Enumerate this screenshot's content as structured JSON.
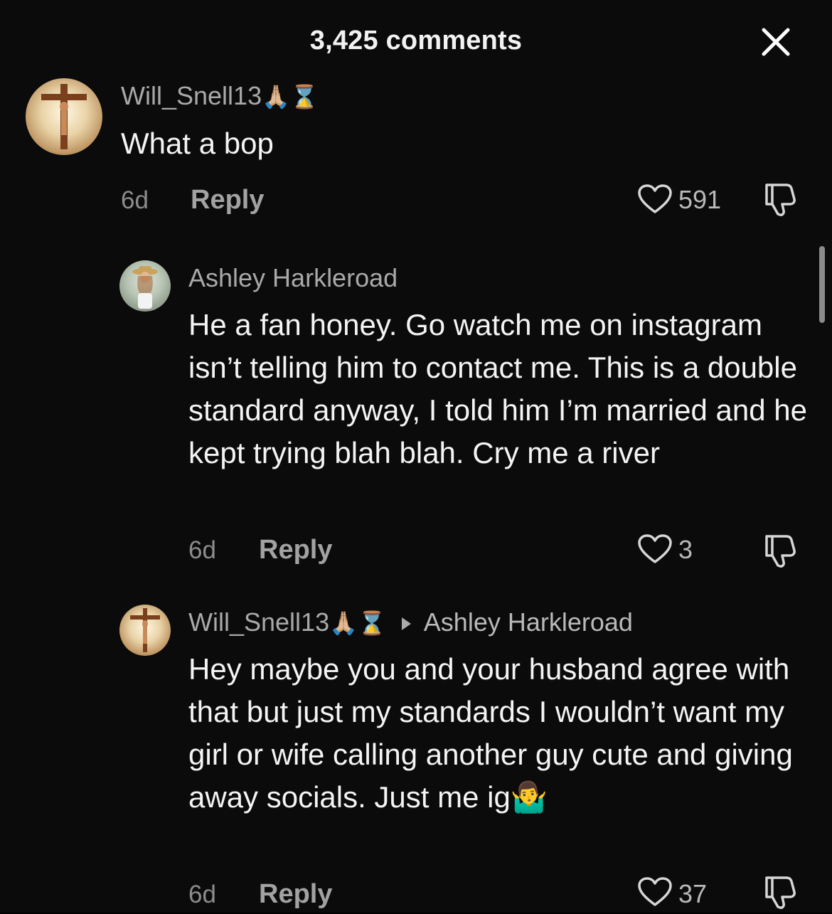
{
  "header": {
    "title": "3,425 comments",
    "close_icon": "close-icon"
  },
  "comments": [
    {
      "username": "Will_Snell13",
      "username_emojis": "🙏🏼⌛",
      "avatar": "crucifix-avatar",
      "text": "What a bop",
      "time": "6d",
      "reply_label": "Reply",
      "likes": "591"
    },
    {
      "username": "Ashley Harkleroad",
      "avatar": "woman-hat-avatar",
      "text": "He a fan honey. Go watch me on instagram isn’t telling him to contact me. This is a double standard anyway, I told him I’m married and he kept trying blah blah. Cry me a river",
      "time": "6d",
      "reply_label": "Reply",
      "likes": "3"
    },
    {
      "username": "Will_Snell13",
      "username_emojis": "🙏🏼⌛",
      "avatar": "crucifix-avatar",
      "reply_to": "Ashley Harkleroad",
      "text": "Hey maybe you and your husband agree with that but just my standards I wouldn’t want my girl or wife calling another guy cute and giving away socials. Just me ig🤷‍♂️",
      "time": "6d",
      "reply_label": "Reply",
      "likes": "37"
    }
  ]
}
